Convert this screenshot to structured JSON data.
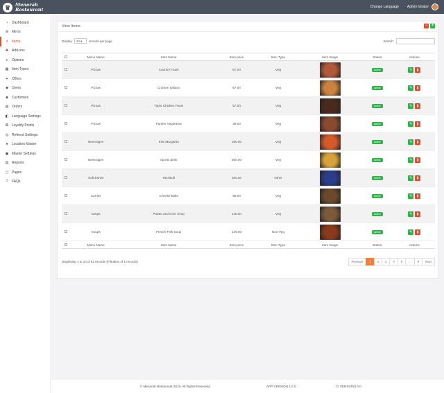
{
  "brand": {
    "line1": "Menorah",
    "line2": "Restaurant"
  },
  "topbar": {
    "change_language": "Change Language",
    "user": "Admin Istrator"
  },
  "sidebar": {
    "items": [
      {
        "label": "Dashboard",
        "icon": "speedometer-icon",
        "glyph": "◔"
      },
      {
        "label": "Menu",
        "icon": "menu-list-icon",
        "glyph": "☰"
      },
      {
        "label": "Items",
        "icon": "cutlery-icon",
        "glyph": "✕",
        "active": true
      },
      {
        "label": "Add-ons",
        "icon": "plus-icon",
        "glyph": "✚"
      },
      {
        "label": "Options",
        "icon": "options-icon",
        "glyph": "≡"
      },
      {
        "label": "Item Types",
        "icon": "grid-icon",
        "glyph": "▦"
      },
      {
        "label": "Offers",
        "icon": "gift-icon",
        "glyph": "✦"
      },
      {
        "label": "Users",
        "icon": "users-icon",
        "glyph": "☻"
      },
      {
        "label": "Customers",
        "icon": "customers-icon",
        "glyph": "☻"
      },
      {
        "label": "Orders",
        "icon": "orders-icon",
        "glyph": "▤"
      },
      {
        "label": "Language Settings",
        "icon": "language-icon",
        "glyph": "◧"
      },
      {
        "label": "Loyality Points",
        "icon": "star-icon",
        "glyph": "✪"
      },
      {
        "label": "Referral Settings",
        "icon": "referral-icon",
        "glyph": "◎"
      },
      {
        "label": "Location Master",
        "icon": "location-icon",
        "glyph": "●"
      },
      {
        "label": "Master Settings",
        "icon": "settings-icon",
        "glyph": "▣"
      },
      {
        "label": "Reports",
        "icon": "reports-icon",
        "glyph": "▥"
      },
      {
        "label": "Pages",
        "icon": "pages-icon",
        "glyph": "▢"
      },
      {
        "label": "FAQs",
        "icon": "faq-icon",
        "glyph": "?"
      }
    ]
  },
  "card": {
    "title": "View Items",
    "display_label": "Display",
    "page_size": "10",
    "per_page_label": "records per page",
    "search_label": "Search:",
    "search_value": ""
  },
  "table": {
    "headers": [
      "Menu Name",
      "Item Name",
      "Item price",
      "Item Type",
      "Item Image",
      "Status",
      "Actions"
    ],
    "rows": [
      {
        "menu": "Pizzas",
        "item": "Country Feast",
        "price": "67.00",
        "type": "Veg",
        "status": "Active",
        "img": "#b0583a"
      },
      {
        "menu": "Pizzas",
        "item": "Chicken Italiano",
        "price": "57.00",
        "type": "Veg",
        "status": "Active",
        "img": "#c9833f"
      },
      {
        "menu": "Pizzas",
        "item": "Triple Chicken Feast",
        "price": "57.00",
        "type": "Veg",
        "status": "Active",
        "img": "#4a2a1c"
      },
      {
        "menu": "Pizzas",
        "item": "Paneer Vegorama",
        "price": "49.00",
        "type": "Veg",
        "status": "Active",
        "img": "#8a4a2e"
      },
      {
        "menu": "Beverages",
        "item": "Kiwi Margarita",
        "price": "260.00",
        "type": "Veg",
        "status": "Active",
        "img": "#d45a2a"
      },
      {
        "menu": "Beverages",
        "item": "Sports drink",
        "price": "300.00",
        "type": "Veg",
        "status": "Active",
        "img": "#d8a23a"
      },
      {
        "menu": "Soft Drinks",
        "item": "Red Bull",
        "price": "100.00",
        "type": "Other",
        "status": "Active",
        "img": "#2a3d8a"
      },
      {
        "menu": "Curries",
        "item": "Cheese Balls",
        "price": "99.00",
        "type": "Veg",
        "status": "Active",
        "img": "#6a4a2a"
      },
      {
        "menu": "Soups",
        "item": "Potato and Corn Soup",
        "price": "119.00",
        "type": "Veg",
        "status": "Active",
        "img": "#7a5a3a"
      },
      {
        "menu": "Soups",
        "item": "French Fish Soup",
        "price": "149.00",
        "type": "Non-Veg",
        "status": "Active",
        "img": "#8a3a1a"
      }
    ]
  },
  "pagination": {
    "info": "Displaying 1 to 10 of 81 records (Filtration of 1 records)",
    "previous": "Previous",
    "pages": [
      "1",
      "2",
      "3",
      "4",
      "5",
      "...",
      "9"
    ],
    "next": "Next"
  },
  "footer": {
    "copyright": "© Menorah Restaurant 2019, All Rights Reserved.",
    "app_version": "APP VERSION 1.0.0",
    "ci_version": "CI VERSION3.0.0"
  },
  "colors": {
    "accent": "#e54b2a",
    "success": "#2fb34a",
    "topbar": "#4a5260",
    "page_active": "#f07f3c"
  }
}
